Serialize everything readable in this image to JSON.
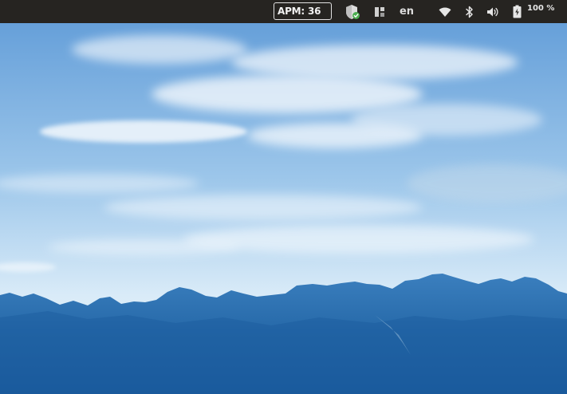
{
  "topbar": {
    "apm_label": "APM: 36",
    "language": "en",
    "battery_percent_label": "100 %"
  },
  "tray_icons": [
    "shield-check-icon",
    "layout-icon",
    "wifi-icon",
    "bluetooth-icon",
    "volume-icon",
    "battery-icon"
  ],
  "colors": {
    "topbar": "#262421",
    "sky_top": "#5e9ad7",
    "sky_bottom": "#d9ebf8",
    "mountains": "#2f6fae",
    "shield_badge": "#4caf50"
  }
}
